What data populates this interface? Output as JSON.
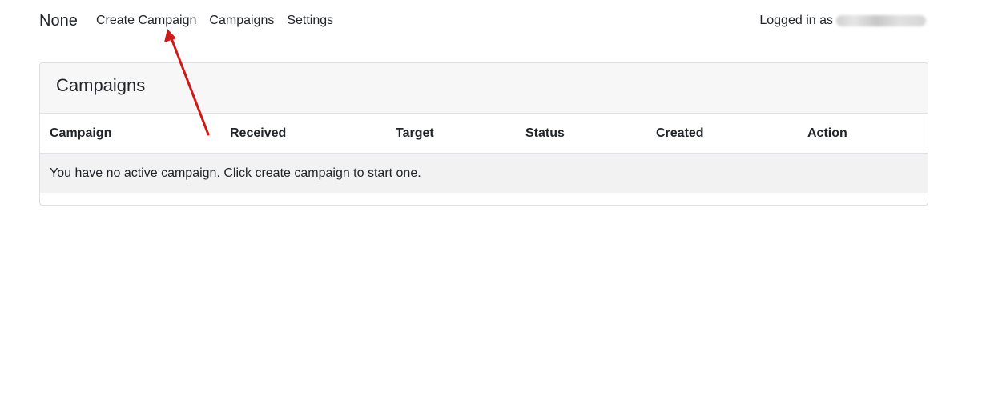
{
  "navbar": {
    "brand": "None",
    "links": [
      {
        "label": "Create Campaign"
      },
      {
        "label": "Campaigns"
      },
      {
        "label": "Settings"
      }
    ],
    "login_label": "Logged in as"
  },
  "card": {
    "title": "Campaigns",
    "table": {
      "columns": [
        "Campaign",
        "Received",
        "Target",
        "Status",
        "Created",
        "Action"
      ],
      "empty_message": "You have no active campaign. Click create campaign to start one."
    }
  },
  "colors": {
    "annotation_arrow": "#cc1a1a",
    "card_header_bg": "#f7f7f7",
    "empty_row_bg": "#f2f2f2"
  }
}
